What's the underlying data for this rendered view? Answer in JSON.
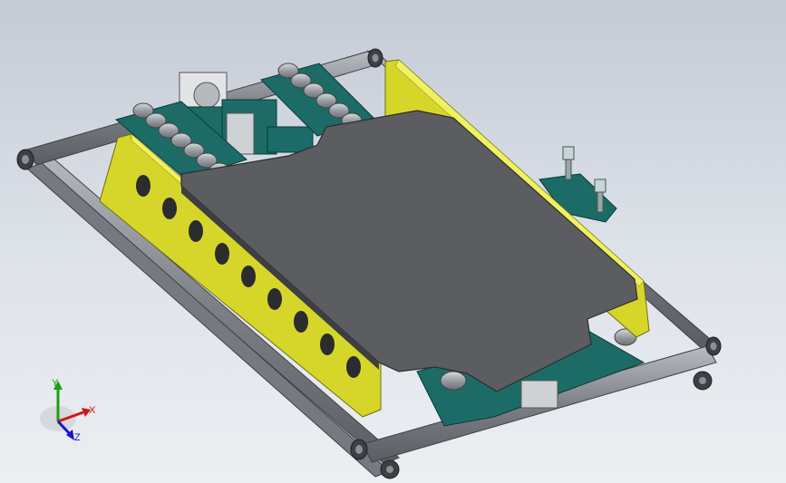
{
  "window": {
    "title": ""
  },
  "triad": {
    "x_label": "X",
    "y_label": "Y",
    "z_label": "Z",
    "x_color": "#d01818",
    "y_color": "#18a018",
    "z_color": "#1818c8"
  },
  "colors": {
    "background_top": "#c4cbd6",
    "background_bottom": "#eceef2",
    "plate": "#5b5d60",
    "frame_yellow": "#d6d62a",
    "bracket_teal": "#1c6b66",
    "roller_gray": "#a9adb2",
    "rail": "#8c9096"
  }
}
